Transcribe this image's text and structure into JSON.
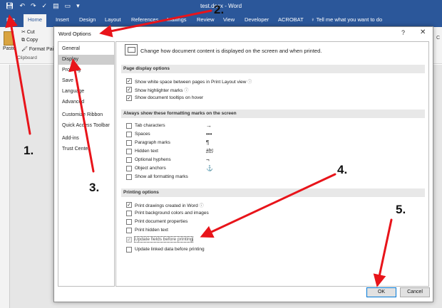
{
  "window": {
    "title": "test.docx  -  Word",
    "qat_icons": [
      "save-icon",
      "undo-icon",
      "redo-icon",
      "spelling-icon",
      "print-preview-icon",
      "open-icon",
      "customize-icon"
    ]
  },
  "ribbon": {
    "tabs": [
      "File",
      "Home",
      "Insert",
      "Design",
      "Layout",
      "References",
      "Mailings",
      "Review",
      "View",
      "Developer",
      "ACROBAT"
    ],
    "active_tab": "Home",
    "tell_me": "Tell me what you want to do",
    "cut": "Cut",
    "copy": "Copy",
    "format_painter": "Format Painter",
    "paste": "Paste",
    "clipboard_group": "Clipboard",
    "right_edge": "C"
  },
  "dialog": {
    "title": "Word Options",
    "help": "?",
    "close": "✕",
    "nav": [
      "General",
      "Display",
      "Proofing",
      "Save",
      "Language",
      "Advanced",
      "Customize Ribbon",
      "Quick Access Toolbar",
      "Add-ins",
      "Trust Center"
    ],
    "nav_selected": "Display",
    "header_text": "Change how document content is displayed on the screen and when printed.",
    "sections": {
      "page_display": {
        "title": "Page display options",
        "options": [
          {
            "label": "Show white space between pages in Print Layout view",
            "checked": true,
            "info": "ⓘ"
          },
          {
            "label": "Show highlighter marks",
            "checked": true,
            "info": "ⓘ"
          },
          {
            "label": "Show document tooltips on hover",
            "checked": true,
            "info": ""
          }
        ]
      },
      "formatting_marks": {
        "title": "Always show these formatting marks on the screen",
        "options": [
          {
            "label": "Tab characters",
            "checked": false,
            "symbol": "→"
          },
          {
            "label": "Spaces",
            "checked": false,
            "symbol": "•••"
          },
          {
            "label": "Paragraph marks",
            "checked": false,
            "symbol": "¶"
          },
          {
            "label": "Hidden text",
            "checked": false,
            "symbol": "abc"
          },
          {
            "label": "Optional hyphens",
            "checked": false,
            "symbol": "¬"
          },
          {
            "label": "Object anchors",
            "checked": false,
            "symbol": "⚓"
          },
          {
            "label": "Show all formatting marks",
            "checked": false,
            "symbol": ""
          }
        ]
      },
      "printing": {
        "title": "Printing options",
        "options": [
          {
            "label": "Print drawings created in Word",
            "checked": true,
            "info": "ⓘ"
          },
          {
            "label": "Print background colors and images",
            "checked": false,
            "info": ""
          },
          {
            "label": "Print document properties",
            "checked": false,
            "info": ""
          },
          {
            "label": "Print hidden text",
            "checked": false,
            "info": ""
          },
          {
            "label": "Update fields before printing",
            "checked": true,
            "info": ""
          },
          {
            "label": "Update linked data before printing",
            "checked": false,
            "info": ""
          }
        ]
      }
    },
    "ok": "OK",
    "cancel": "Cancel"
  },
  "annotations": {
    "numbers": [
      "1.",
      "2.",
      "3.",
      "4.",
      "5."
    ],
    "arrow_color": "#e8141a"
  },
  "colors": {
    "word_blue": "#2b579a",
    "nav_selected_bg": "#cdcdcd",
    "section_bg": "#e8e8e8",
    "accent": "#0078d7"
  }
}
